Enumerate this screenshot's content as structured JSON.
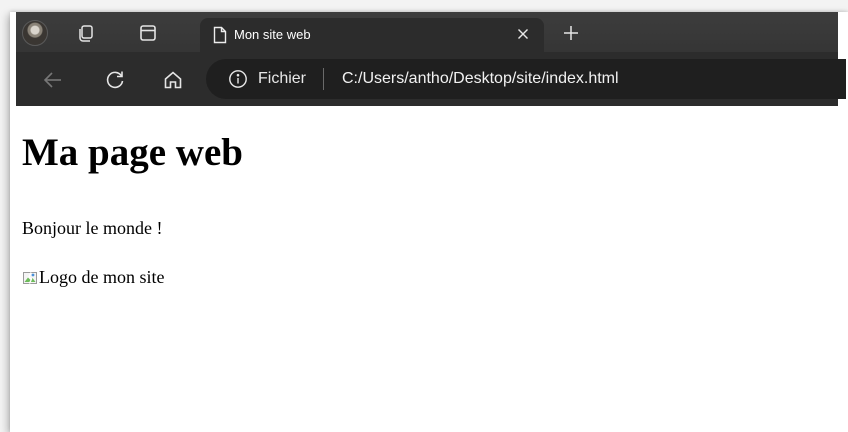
{
  "browser": {
    "tab": {
      "title": "Mon site web",
      "close_glyph": "✕",
      "new_tab_glyph": "+"
    },
    "address_bar": {
      "scheme_label": "Fichier",
      "url": "C:/Users/antho/Desktop/site/index.html"
    },
    "icons": {
      "profile": "avatar",
      "workspaces": "workspaces-icon",
      "tab_actions": "tab-actions-icon",
      "page": "page-icon",
      "back": "back-arrow-icon",
      "refresh": "refresh-icon",
      "home": "home-icon",
      "info": "info-icon"
    },
    "colors": {
      "tabstrip": "#3b3b3b",
      "toolbar": "#2c2c2c",
      "address_bar": "#1f1f1f",
      "page_background": "#ffffff"
    }
  },
  "page": {
    "heading": "Ma page web",
    "paragraph": "Bonjour le monde !",
    "image_alt": "Logo de mon site"
  }
}
